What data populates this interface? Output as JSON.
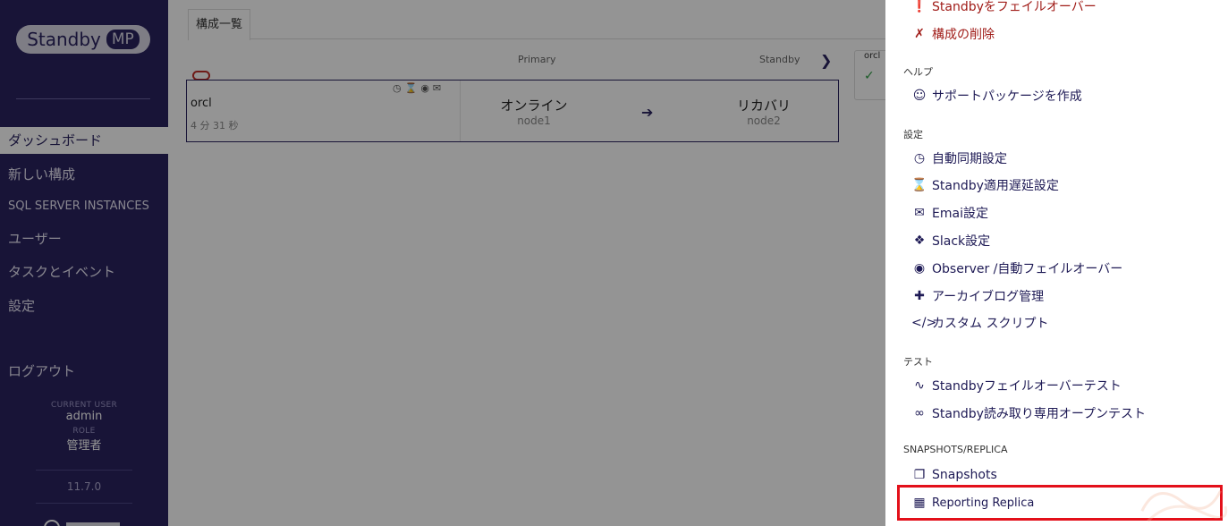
{
  "sidebar": {
    "logo_text": "Standby",
    "logo_badge": "MP",
    "nav": [
      {
        "label": "ダッシュボード",
        "active": true
      },
      {
        "label": "新しい構成"
      },
      {
        "label": "SQL SERVER INSTANCES"
      },
      {
        "label": "ユーザー"
      },
      {
        "label": "タスクとイベント"
      },
      {
        "label": "設定"
      }
    ],
    "logout": "ログアウト",
    "current_user_caption": "CURRENT USER",
    "current_user": "admin",
    "role_caption": "ROLE",
    "role": "管理者",
    "version": "11.7.0"
  },
  "main": {
    "tab_label": "構成一覧",
    "header_primary": "Primary",
    "header_standby": "Standby",
    "card": {
      "name": "orcl",
      "elapsed": "4 分 31 秒",
      "primary_status": "オンライン",
      "primary_node": "node1",
      "standby_status": "リカバリ",
      "standby_node": "node2"
    },
    "mini_card_label": "orcl"
  },
  "panel": {
    "items_top": [
      {
        "label": "Standbyをフェイルオーバー",
        "icon": "alert-circle-icon"
      },
      {
        "label": "構成の削除",
        "icon": "unlink-icon"
      }
    ],
    "section_help": "ヘルプ",
    "help_items": [
      {
        "label": "サポートパッケージを作成",
        "icon": "support-icon"
      }
    ],
    "section_settings": "設定",
    "settings_items": [
      {
        "label": "自動同期設定",
        "icon": "clock-icon"
      },
      {
        "label": "Standby適用遅延設定",
        "icon": "hourglass-icon"
      },
      {
        "label": "Emai設定",
        "icon": "envelope-icon"
      },
      {
        "label": "Slack設定",
        "icon": "slack-icon"
      },
      {
        "label": "Observer /自動フェイルオーバー",
        "icon": "eye-icon"
      },
      {
        "label": "アーカイブログ管理",
        "icon": "file-plus-icon"
      },
      {
        "label": "カスタム スクリプト",
        "icon": "code-icon"
      }
    ],
    "section_test": "テスト",
    "test_items": [
      {
        "label": "Standbyフェイルオーバーテスト",
        "icon": "pulse-icon"
      },
      {
        "label": "Standby読み取り専用オープンテスト",
        "icon": "glasses-icon"
      }
    ],
    "section_snapshots": "SNAPSHOTS/REPLICA",
    "snapshot_items": [
      {
        "label": "Snapshots",
        "icon": "copy-icon"
      },
      {
        "label": "Reporting Replica",
        "icon": "grid-icon"
      }
    ]
  },
  "colors": {
    "sidebar_bg": "#2a2360",
    "accent": "#1e1a55",
    "danger": "#a01c18",
    "highlight": "#e3101a"
  }
}
